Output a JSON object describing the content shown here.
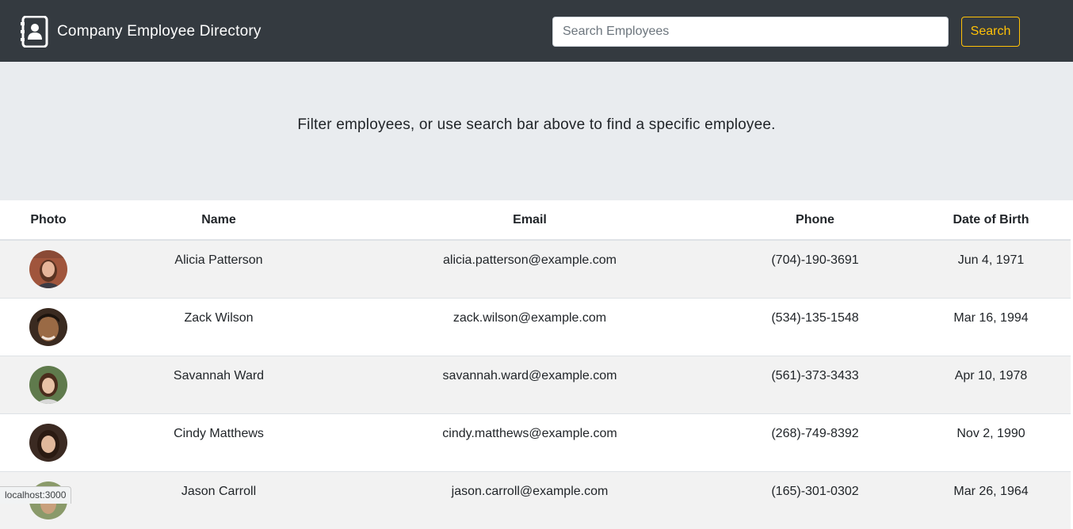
{
  "navbar": {
    "title": "Company Employee Directory",
    "icon": "address-book-icon",
    "search": {
      "placeholder": "Search Employees",
      "value": ""
    },
    "search_button_label": "Search",
    "accent_color": "#ffc107",
    "background_color": "#343a40"
  },
  "jumbotron": {
    "lead": "Filter employees, or use search bar above to find a specific employee."
  },
  "table": {
    "headers": [
      "Photo",
      "Name",
      "Email",
      "Phone",
      "Date of Birth"
    ],
    "rows": [
      {
        "name": "Alicia Patterson",
        "email": "alicia.patterson@example.com",
        "phone": "(704)-190-3691",
        "dob": "Jun 4, 1971"
      },
      {
        "name": "Zack Wilson",
        "email": "zack.wilson@example.com",
        "phone": "(534)-135-1548",
        "dob": "Mar 16, 1994"
      },
      {
        "name": "Savannah Ward",
        "email": "savannah.ward@example.com",
        "phone": "(561)-373-3433",
        "dob": "Apr 10, 1978"
      },
      {
        "name": "Cindy Matthews",
        "email": "cindy.matthews@example.com",
        "phone": "(268)-749-8392",
        "dob": "Nov 2, 1990"
      },
      {
        "name": "Jason Carroll",
        "email": "jason.carroll@example.com",
        "phone": "(165)-301-0302",
        "dob": "Mar 26, 1964"
      }
    ]
  },
  "status_bar": {
    "url": "localhost:3000"
  }
}
